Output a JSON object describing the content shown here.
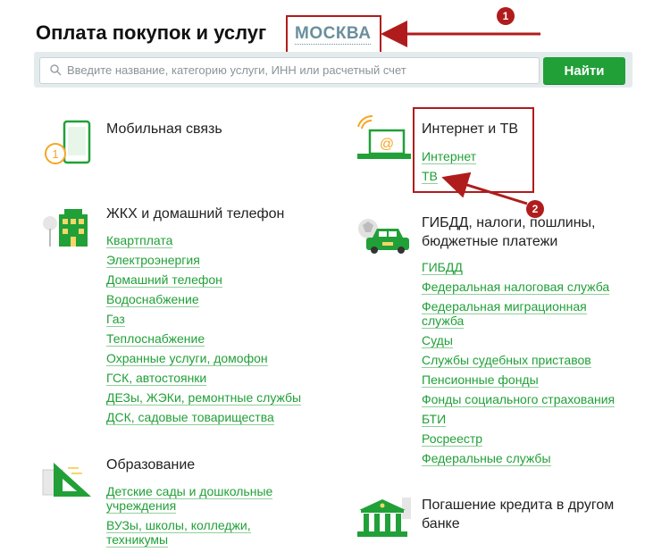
{
  "header": {
    "title": "Оплата покупок и услуг",
    "city": "МОСКВА"
  },
  "search": {
    "placeholder": "Введите название, категорию услуги, ИНН или расчетный счет",
    "button": "Найти"
  },
  "annotations": {
    "badge_1": "1",
    "badge_2": "2",
    "color": "#b01c1c"
  },
  "colors": {
    "accent": "#21a038",
    "city": "#6a8f9c",
    "icon_orange": "#f5a623"
  },
  "categories": {
    "mobile": {
      "title": "Мобильная связь",
      "icon": "mobile-phone-icon",
      "links": []
    },
    "internet": {
      "title": "Интернет и ТВ",
      "icon": "laptop-wifi-icon",
      "links": [
        "Интернет",
        "ТВ"
      ]
    },
    "housing": {
      "title": "ЖКХ и домашний телефон",
      "icon": "apartment-building-icon",
      "links": [
        "Квартплата",
        "Электроэнергия",
        "Домашний телефон",
        "Водоснабжение",
        "Газ",
        "Теплоснабжение",
        "Охранные услуги, домофон",
        "ГСК, автостоянки",
        "ДЕЗы, ЖЭКи, ремонтные службы",
        "ДСК, садовые товарищества"
      ]
    },
    "gibdd": {
      "title_line1": "ГИБДД, налоги, пошлины,",
      "title_line2": "бюджетные платежи",
      "icon": "car-emblem-icon",
      "links": [
        "ГИБДД",
        "Федеральная налоговая служба",
        "Федеральная миграционная",
        "служба",
        "Суды",
        "Службы судебных приставов",
        "Пенсионные фонды",
        "Фонды социального страхования",
        "БТИ",
        "Росреестр",
        "Федеральные службы"
      ]
    },
    "education": {
      "title": "Образование",
      "icon": "set-square-icon",
      "links": [
        "Детские сады и дошкольные",
        "учреждения",
        "ВУЗы, школы, колледжи,",
        "техникумы"
      ]
    },
    "credit": {
      "title_line1": "Погашение кредита в другом",
      "title_line2": "банке",
      "icon": "bank-building-icon"
    }
  }
}
